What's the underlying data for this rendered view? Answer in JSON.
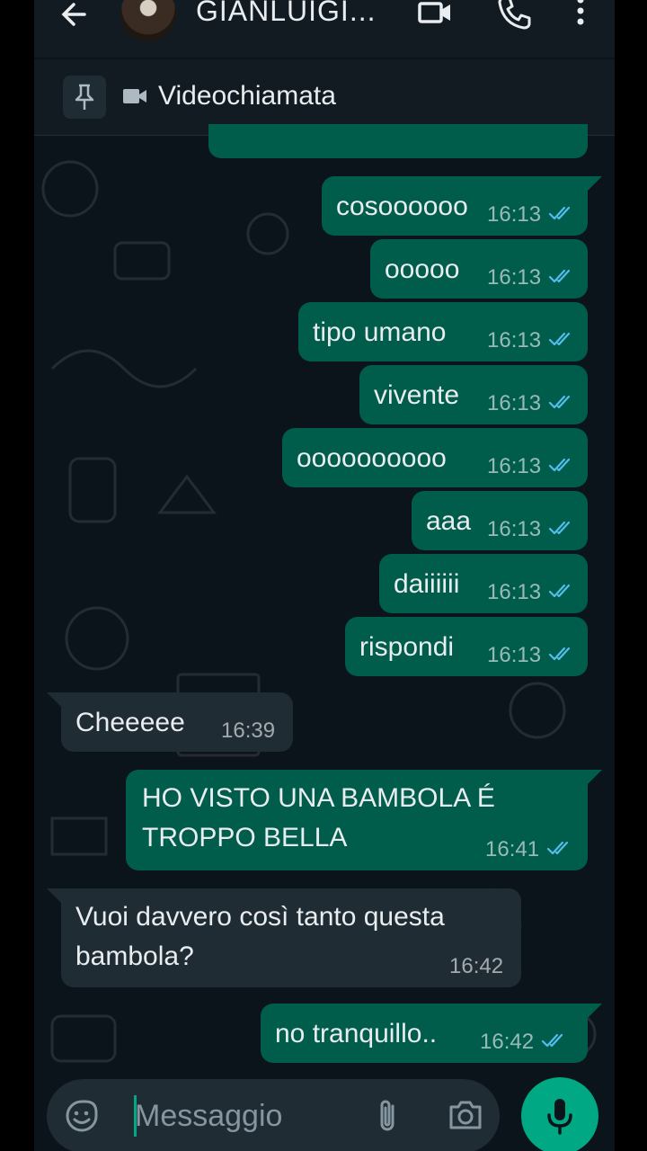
{
  "header": {
    "contact_name": "GIANLUIGI...",
    "icons": [
      "arrow-left-icon",
      "video-call-icon",
      "phone-icon",
      "more-vertical-icon"
    ]
  },
  "pinned": {
    "label": "Videochiamata",
    "icons": [
      "pin-icon",
      "videocam-icon"
    ]
  },
  "messages": [
    {
      "dir": "out",
      "text": "cosoooooo",
      "time": "16:13",
      "status": "read"
    },
    {
      "dir": "out",
      "text": "ooooo",
      "time": "16:13",
      "status": "read"
    },
    {
      "dir": "out",
      "text": "tipo umano",
      "time": "16:13",
      "status": "read"
    },
    {
      "dir": "out",
      "text": "vivente",
      "time": "16:13",
      "status": "read"
    },
    {
      "dir": "out",
      "text": "oooooooooo",
      "time": "16:13",
      "status": "read"
    },
    {
      "dir": "out",
      "text": "aaa",
      "time": "16:13",
      "status": "read"
    },
    {
      "dir": "out",
      "text": "daiiiiii",
      "time": "16:13",
      "status": "read"
    },
    {
      "dir": "out",
      "text": "rispondi",
      "time": "16:13",
      "status": "read"
    },
    {
      "dir": "in",
      "text": "Cheeeee",
      "time": "16:39"
    },
    {
      "dir": "out",
      "text": "HO VISTO UNA BAMBOLA É TROPPO BELLA",
      "time": "16:41",
      "status": "read"
    },
    {
      "dir": "in",
      "text": "Vuoi davvero così tanto questa bambola?",
      "time": "16:42"
    },
    {
      "dir": "out",
      "text": "no tranquillo..",
      "time": "16:42",
      "status": "read"
    }
  ],
  "composer": {
    "placeholder": "Messaggio",
    "icons": [
      "sticker-icon",
      "attach-icon",
      "camera-icon",
      "mic-icon"
    ]
  },
  "colors": {
    "background": "#0b141a",
    "outgoing_bubble": "#005c4b",
    "incoming_bubble": "#202c33",
    "read_tick": "#53bdeb",
    "accent": "#00a884"
  }
}
